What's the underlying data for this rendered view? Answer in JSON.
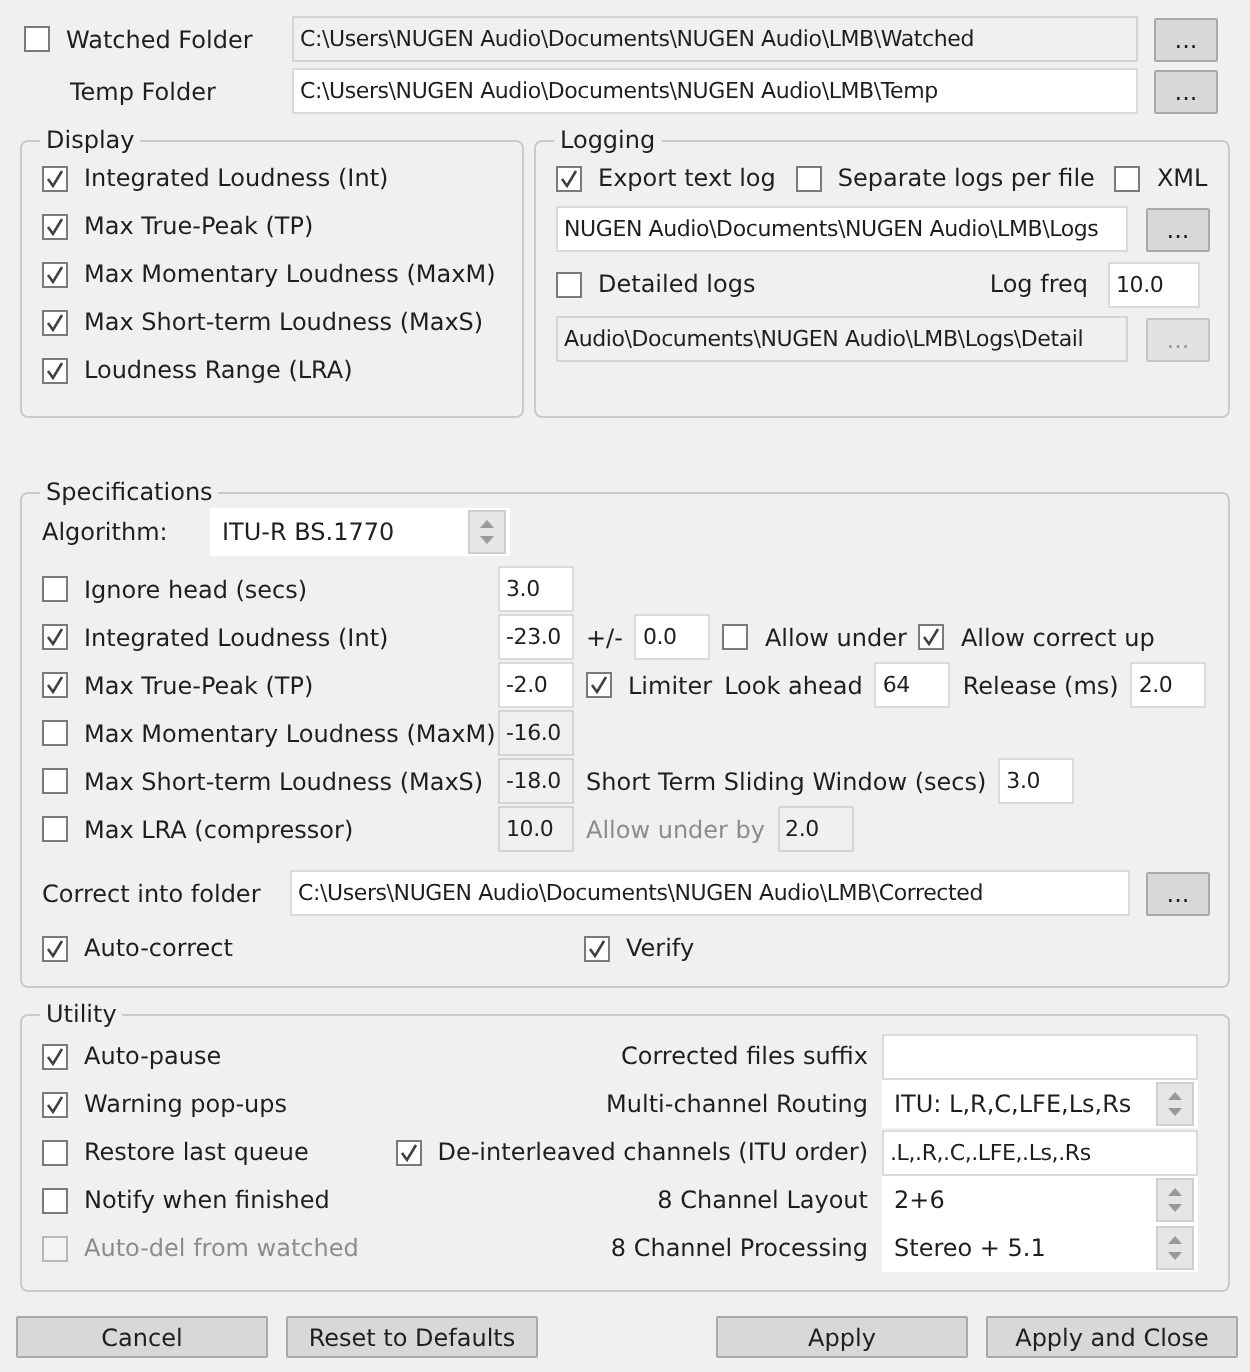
{
  "watched_folder": {
    "label": "Watched Folder",
    "checked": false,
    "path": "C:\\Users\\NUGEN Audio\\Documents\\NUGEN Audio\\LMB\\Watched",
    "path_disabled": true,
    "browse": "..."
  },
  "temp_folder": {
    "label": "Temp Folder",
    "path": "C:\\Users\\NUGEN Audio\\Documents\\NUGEN Audio\\LMB\\Temp",
    "browse": "..."
  },
  "display": {
    "title": "Display",
    "items": [
      {
        "label": "Integrated Loudness (Int)",
        "checked": true
      },
      {
        "label": "Max True-Peak (TP)",
        "checked": true
      },
      {
        "label": "Max Momentary Loudness (MaxM)",
        "checked": true
      },
      {
        "label": "Max Short-term Loudness (MaxS)",
        "checked": true
      },
      {
        "label": "Loudness Range (LRA)",
        "checked": true
      }
    ]
  },
  "logging": {
    "title": "Logging",
    "options": [
      {
        "label": "Export text log",
        "checked": true
      },
      {
        "label": "Separate logs per file",
        "checked": false
      },
      {
        "label": "XML",
        "checked": false
      }
    ],
    "log_path": "NUGEN Audio\\Documents\\NUGEN Audio\\LMB\\Logs",
    "log_browse": "...",
    "detailed_logs": {
      "label": "Detailed logs",
      "checked": false
    },
    "log_freq_label": "Log freq",
    "log_freq": "10.0",
    "detail_path": {
      "value": "Audio\\Documents\\NUGEN Audio\\LMB\\Logs\\Detail",
      "disabled": true
    },
    "detail_browse": {
      "label": "...",
      "disabled": true
    }
  },
  "specifications": {
    "title": "Specifications",
    "algorithm_label": "Algorithm:",
    "algorithm": "ITU-R BS.1770",
    "rows": [
      {
        "label": "Ignore head (secs)",
        "checked": false,
        "field": {
          "value": "3.0",
          "disabled": false
        },
        "extras": []
      },
      {
        "label": "Integrated Loudness (Int)",
        "checked": true,
        "field": {
          "value": "-23.0",
          "disabled": false
        },
        "extras": [
          {
            "kind": "text",
            "text": "+/-",
            "disabled": false
          },
          {
            "kind": "field",
            "value": "0.0",
            "disabled": false
          },
          {
            "kind": "check",
            "label": "Allow under",
            "checked": false
          },
          {
            "kind": "check",
            "label": "Allow correct up",
            "checked": true
          }
        ]
      },
      {
        "label": "Max True-Peak (TP)",
        "checked": true,
        "field": {
          "value": "-2.0",
          "disabled": false
        },
        "extras": [
          {
            "kind": "check",
            "label": "Limiter",
            "checked": true
          },
          {
            "kind": "text",
            "text": "Look ahead",
            "disabled": false
          },
          {
            "kind": "field",
            "value": "64",
            "disabled": false
          },
          {
            "kind": "text",
            "text": "Release (ms)",
            "disabled": false
          },
          {
            "kind": "field",
            "value": "2.0",
            "disabled": false
          }
        ]
      },
      {
        "label": "Max Momentary Loudness (MaxM)",
        "checked": false,
        "field": {
          "value": "-16.0",
          "disabled": true
        },
        "extras": []
      },
      {
        "label": "Max Short-term Loudness (MaxS)",
        "checked": false,
        "field": {
          "value": "-18.0",
          "disabled": true
        },
        "extras": [
          {
            "kind": "text",
            "text": "Short Term Sliding Window (secs)",
            "disabled": false
          },
          {
            "kind": "field",
            "value": "3.0",
            "disabled": false
          }
        ]
      },
      {
        "label": "Max LRA (compressor)",
        "checked": false,
        "field": {
          "value": "10.0",
          "disabled": true
        },
        "extras": [
          {
            "kind": "text",
            "text": "Allow under by",
            "disabled": true
          },
          {
            "kind": "field",
            "value": "2.0",
            "disabled": true
          }
        ]
      }
    ],
    "correct_folder_label": "Correct into folder",
    "correct_folder": "C:\\Users\\NUGEN Audio\\Documents\\NUGEN Audio\\LMB\\Corrected",
    "correct_browse": "...",
    "options": [
      {
        "label": "Auto-correct",
        "checked": true
      },
      {
        "label": "Verify",
        "checked": true
      }
    ]
  },
  "utility": {
    "title": "Utility",
    "options": [
      {
        "label": "Auto-pause",
        "checked": true,
        "disabled": false
      },
      {
        "label": "Warning pop-ups",
        "checked": true,
        "disabled": false
      },
      {
        "label": "Restore last queue",
        "checked": false,
        "disabled": false
      },
      {
        "label": "Notify when finished",
        "checked": false,
        "disabled": false
      },
      {
        "label": "Auto-del from watched",
        "checked": false,
        "disabled": true
      }
    ],
    "settings": [
      {
        "kind": "field",
        "label": "Corrected files suffix"
      },
      {
        "kind": "combo",
        "label": "Multi-channel Routing",
        "value": "ITU: L,R,C,LFE,Ls,Rs"
      },
      {
        "kind": "check_field",
        "label": "De-interleaved channels (ITU order)",
        "checked": true,
        "value": ".L,.R,.C,.LFE,.Ls,.Rs"
      },
      {
        "kind": "combo",
        "label": "8 Channel Layout",
        "value": "2+6"
      },
      {
        "kind": "combo",
        "label": "8 Channel Processing",
        "value": "Stereo + 5.1"
      }
    ]
  },
  "buttons": {
    "left": [
      {
        "label": "Cancel"
      },
      {
        "label": "Reset to Defaults"
      }
    ],
    "right": [
      {
        "label": "Apply"
      },
      {
        "label": "Apply and Close"
      }
    ]
  }
}
